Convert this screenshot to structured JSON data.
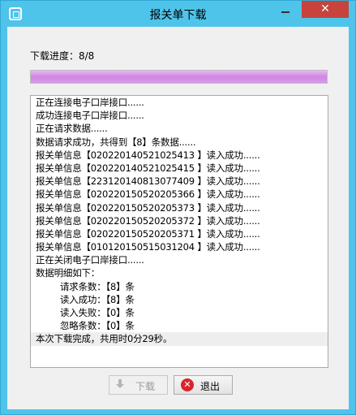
{
  "window": {
    "title": "报关单下载",
    "close_glyph": "✕",
    "minimize_icon": "minimize-icon",
    "app_icon": "app-icon"
  },
  "progress": {
    "label": "下载进度：8/8",
    "fraction": 1.0
  },
  "log": {
    "lines": [
      {
        "text": "正在连接电子口岸接口......",
        "indent": false
      },
      {
        "text": "成功连接电子口岸接口......",
        "indent": false
      },
      {
        "text": "正在请求数据......",
        "indent": false
      },
      {
        "text": "数据请求成功，共得到【8】条数据......",
        "indent": false
      },
      {
        "text": "报关单信息【020220140521025413 】读入成功......",
        "indent": false
      },
      {
        "text": "报关单信息【020220140521025415 】读入成功......",
        "indent": false
      },
      {
        "text": "报关单信息【223120140813077409 】读入成功......",
        "indent": false
      },
      {
        "text": "报关单信息【020220150520205366 】读入成功......",
        "indent": false
      },
      {
        "text": "报关单信息【020220150520205373 】读入成功......",
        "indent": false
      },
      {
        "text": "报关单信息【020220150520205372 】读入成功......",
        "indent": false
      },
      {
        "text": "报关单信息【020220150520205371 】读入成功......",
        "indent": false
      },
      {
        "text": "报关单信息【010120150515031204 】读入成功......",
        "indent": false
      },
      {
        "text": "正在关闭电子口岸接口......",
        "indent": false
      },
      {
        "text": "数据明细如下：",
        "indent": false
      },
      {
        "text": "请求条数：【8】条",
        "indent": true
      },
      {
        "text": "读入成功：【8】条",
        "indent": true
      },
      {
        "text": "读入失败：【0】条",
        "indent": true
      },
      {
        "text": "忽略条数：【0】条",
        "indent": true
      },
      {
        "text": "本次下载完成，共用时0分29秒。",
        "indent": false
      }
    ]
  },
  "buttons": {
    "download_label": "下载",
    "exit_label": "退出",
    "exit_icon_glyph": "✕"
  },
  "colors": {
    "titlebar": "#4fc4ea",
    "progress_fill": "#cf86e3",
    "close_button": "#c7433b",
    "exit_icon": "#d6252b"
  }
}
